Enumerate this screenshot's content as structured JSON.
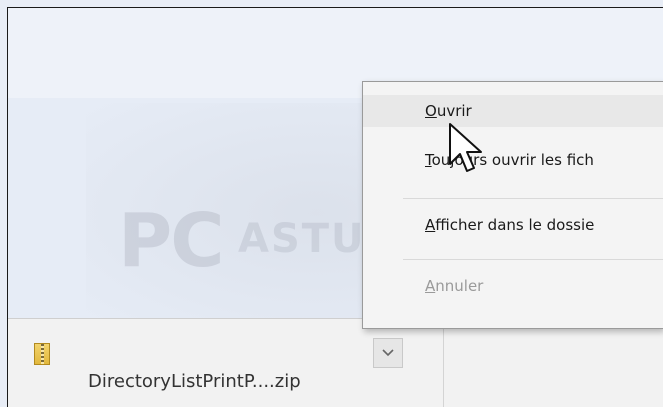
{
  "download_bar": {
    "file_name": "DirectoryListPrintP....zip",
    "file_icon": "zip-archive-icon",
    "menu_button_icon": "chevron-down-icon"
  },
  "context_menu": {
    "items": [
      {
        "label": "Ouvrir",
        "underline": "O",
        "state": "hover"
      },
      {
        "label": "Toujours ouvrir les fich",
        "underline": "T",
        "state": "normal"
      },
      {
        "label": "Afficher dans le dossie",
        "underline": "A",
        "state": "normal"
      },
      {
        "label": "Annuler",
        "underline": "A",
        "state": "disabled"
      }
    ]
  },
  "watermark": {
    "text_left": "PC",
    "text_right": "ASTUCES"
  },
  "colors": {
    "background": "#e6ecf6",
    "menu_bg": "#f4f4f4",
    "disabled_text": "#9a9a9a"
  }
}
